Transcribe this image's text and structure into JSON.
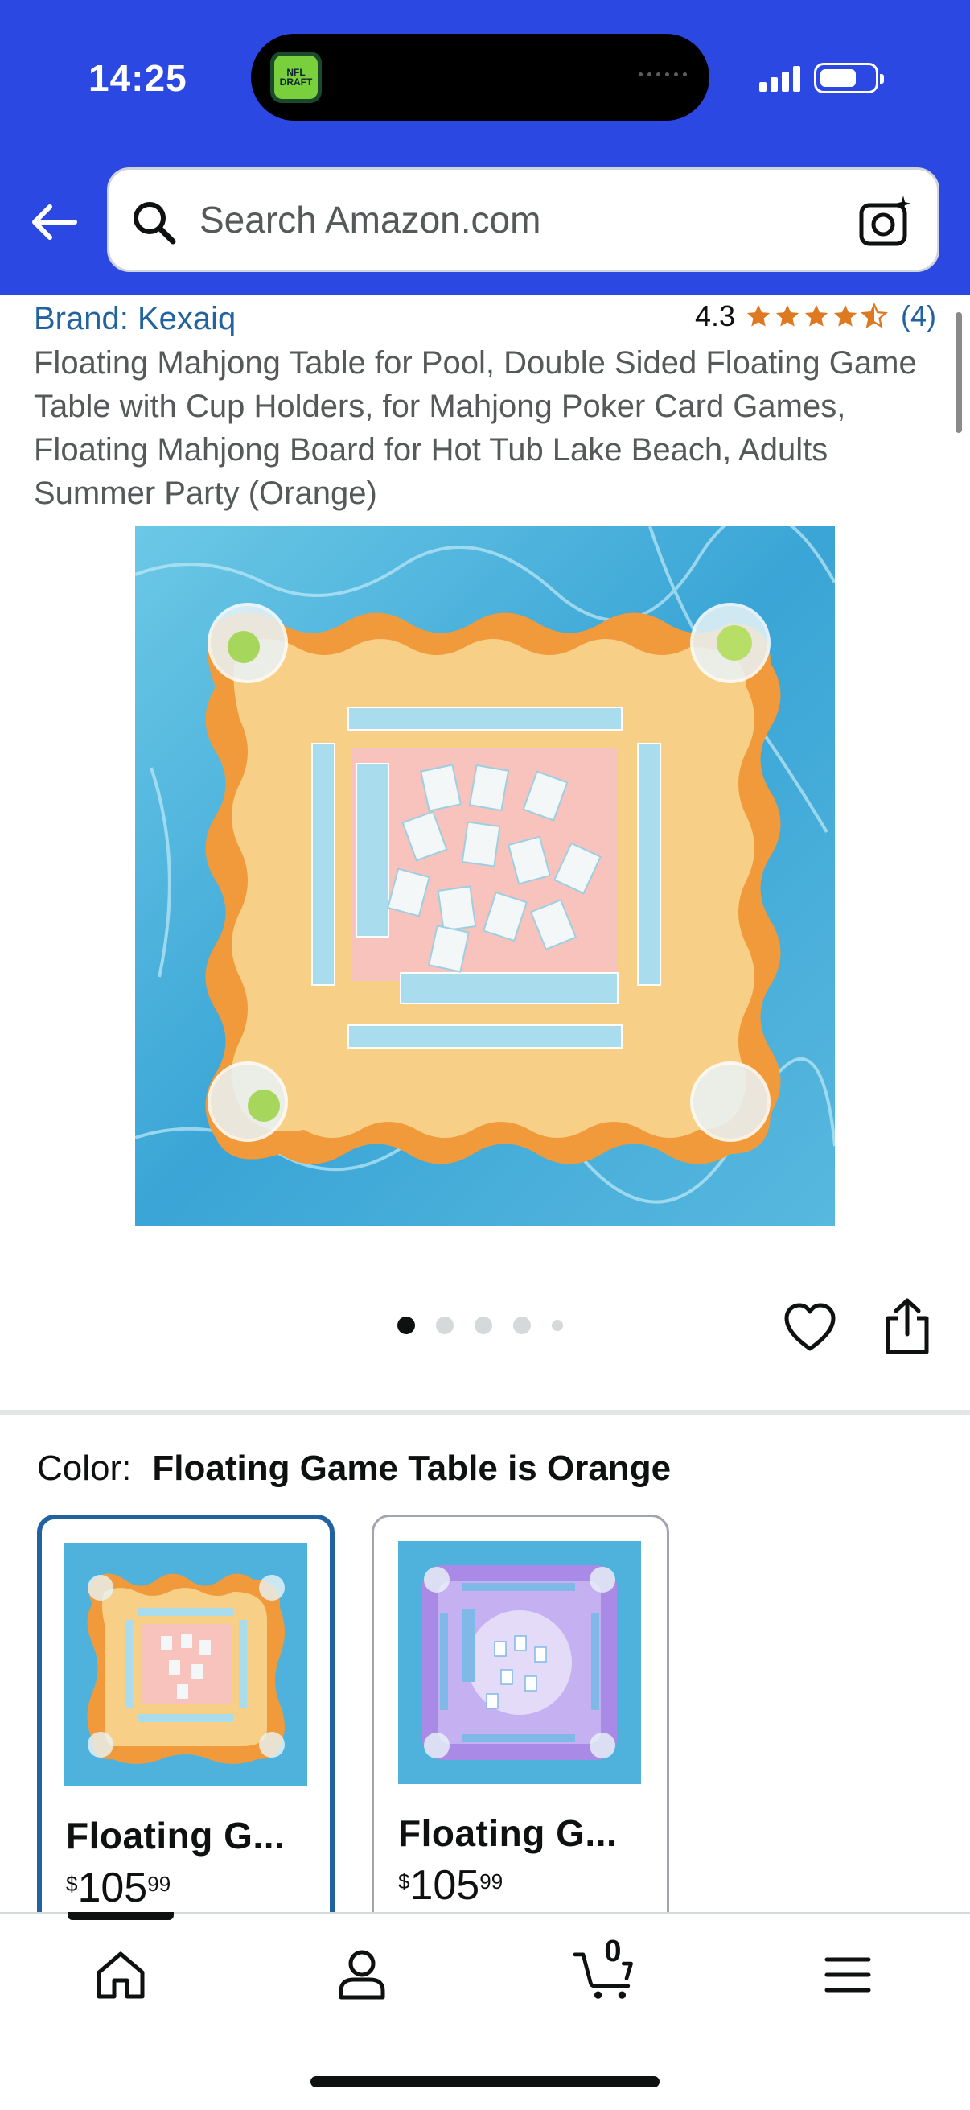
{
  "status_bar": {
    "time": "14:25",
    "live_activity_app": "NFL DRAFT"
  },
  "header": {
    "search_placeholder": "Search Amazon.com",
    "icons": [
      "back-arrow-icon",
      "search-icon",
      "camera-lens-icon"
    ]
  },
  "product": {
    "brand": "Brand: Kexaiq",
    "rating": "4.3",
    "rating_stars": 4.3,
    "rating_count": "(4)",
    "title": "Floating Mahjong Table for Pool, Double Sided Floating Game Table with Cup Holders, for Mahjong Poker Card Games, Floating Mahjong Board for Hot Tub Lake Beach, Adults Summer Party (Orange)",
    "image_count": 5,
    "active_image": 1
  },
  "color_selector": {
    "label": "Color:",
    "selected_value": "Floating Game Table is Orange",
    "options": [
      {
        "name": "Floating G...",
        "price_symbol": "$",
        "price_whole": "105",
        "price_fraction": "99",
        "selected": true,
        "theme": "orange"
      },
      {
        "name": "Floating G...",
        "price_symbol": "$",
        "price_whole": "105",
        "price_fraction": "99",
        "selected": false,
        "theme": "purple"
      }
    ]
  },
  "bottom_nav": {
    "items": [
      "home-icon",
      "account-icon",
      "cart-icon",
      "menu-icon"
    ],
    "cart_count": "0",
    "active": "home"
  },
  "colors": {
    "header_blue": "#2b48e3",
    "link_blue": "#2162a1",
    "star_orange": "#de7921",
    "selected_border": "#2162a1"
  }
}
